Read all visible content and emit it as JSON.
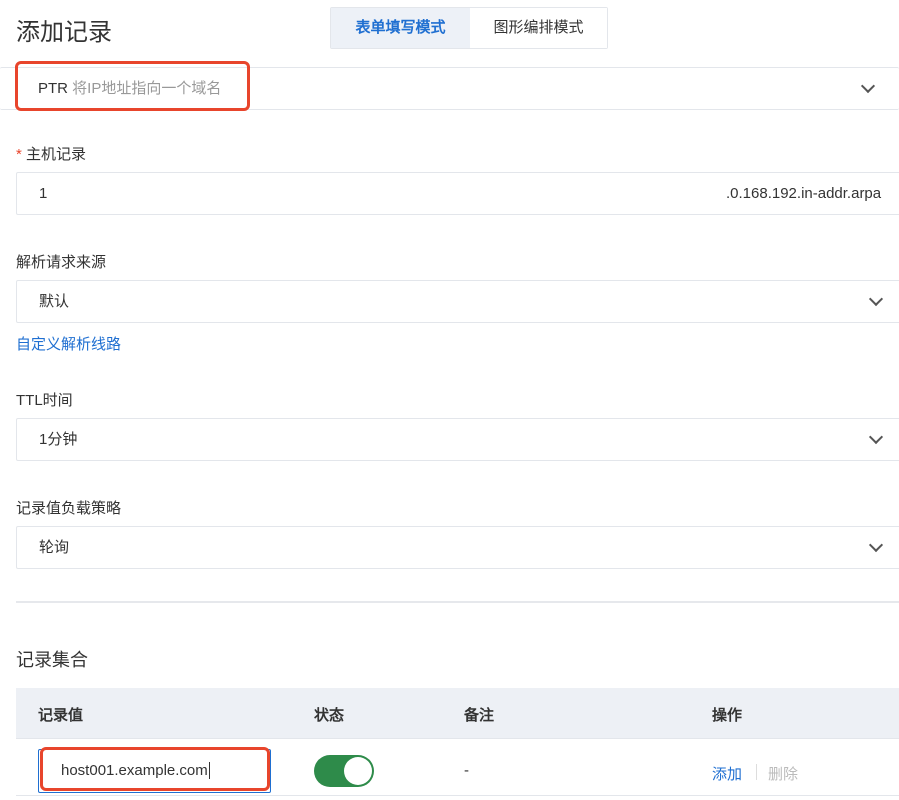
{
  "title": "添加记录",
  "modes": {
    "form": "表单填写模式",
    "graphic": "图形编排模式"
  },
  "record_type": {
    "type": "PTR",
    "desc": "将IP地址指向一个域名"
  },
  "host": {
    "label": "主机记录",
    "required": "*",
    "value": "1",
    "suffix": ".0.168.192.in-addr.arpa"
  },
  "source": {
    "label": "解析请求来源",
    "value": "默认",
    "link": "自定义解析线路"
  },
  "ttl": {
    "label": "TTL时间",
    "value": "1分钟"
  },
  "policy": {
    "label": "记录值负载策略",
    "value": "轮询"
  },
  "records": {
    "title": "记录集合",
    "headers": [
      "记录值",
      "状态",
      "备注",
      "操作"
    ],
    "rows": [
      {
        "value": "host001.example.com",
        "enabled": true,
        "note": "-",
        "add": "添加",
        "delete": "删除"
      }
    ]
  },
  "colors": {
    "accent": "#1f6fd1",
    "toggle": "#2e8b4a",
    "highlight": "#e8452c"
  }
}
